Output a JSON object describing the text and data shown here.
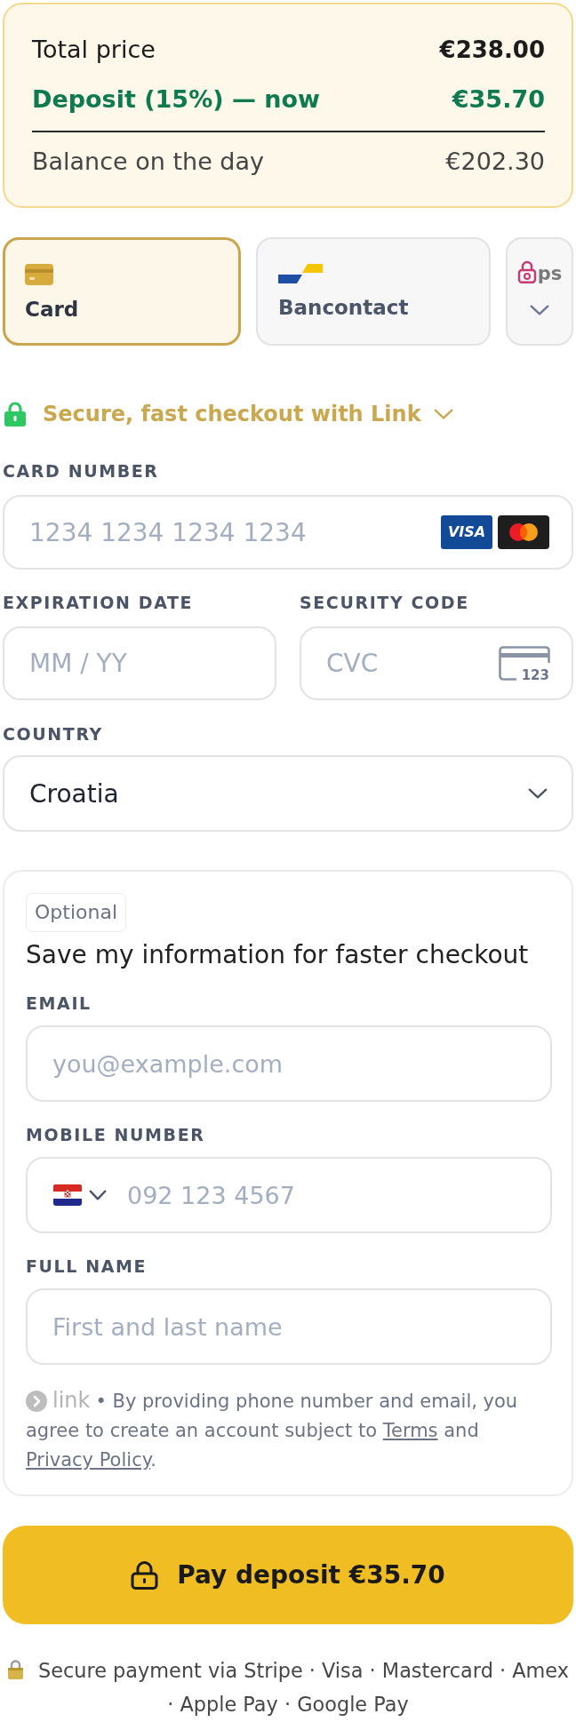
{
  "summary": {
    "rows": [
      {
        "kind": "total",
        "label": "Total price",
        "amount": "€238.00"
      },
      {
        "kind": "deposit",
        "label": "Deposit (15%) — now",
        "amount": "€35.70"
      },
      {
        "kind": "balance",
        "label": "Balance on the day",
        "amount": "€202.30"
      }
    ]
  },
  "payment_methods": [
    {
      "kind": "card",
      "label": "Card",
      "selected": true
    },
    {
      "kind": "bancontact",
      "label": "Bancontact",
      "selected": false
    },
    {
      "kind": "more",
      "logo_text": "ps",
      "selected": false
    }
  ],
  "link_checkout": {
    "label": "Secure, fast checkout with Link"
  },
  "card_number": {
    "label": "CARD NUMBER",
    "placeholder": "1234 1234 1234 1234",
    "brands": [
      {
        "kind": "visa",
        "text": "VISA"
      },
      {
        "kind": "mastercard"
      }
    ]
  },
  "expiration": {
    "label": "EXPIRATION DATE",
    "placeholder": "MM / YY"
  },
  "security_code": {
    "label": "SECURITY CODE",
    "placeholder": "CVC",
    "icon_text": "123"
  },
  "country": {
    "label": "COUNTRY",
    "value": "Croatia"
  },
  "save_info": {
    "badge": "Optional",
    "title": "Save my information for faster checkout",
    "fields": [
      {
        "kind": "email",
        "label": "EMAIL",
        "placeholder": "you@example.com"
      },
      {
        "kind": "phone",
        "label": "MOBILE NUMBER",
        "placeholder": "092 123 4567"
      },
      {
        "kind": "name",
        "label": "FULL NAME",
        "placeholder": "First and last name"
      }
    ],
    "legal": {
      "logo_text": "link",
      "parts": [
        {
          "kind": "text",
          "text": "• By providing phone number and email, you agree to create an account subject to "
        },
        {
          "kind": "link",
          "text": "Terms"
        },
        {
          "kind": "text",
          "text": " and "
        },
        {
          "kind": "link",
          "text": "Privacy Policy"
        },
        {
          "kind": "text",
          "text": "."
        }
      ]
    }
  },
  "pay_button": {
    "label": "Pay deposit €35.70"
  },
  "footer": {
    "text": "Secure payment via Stripe · Visa · Mastercard · Amex · Apple Pay · Google Pay"
  }
}
